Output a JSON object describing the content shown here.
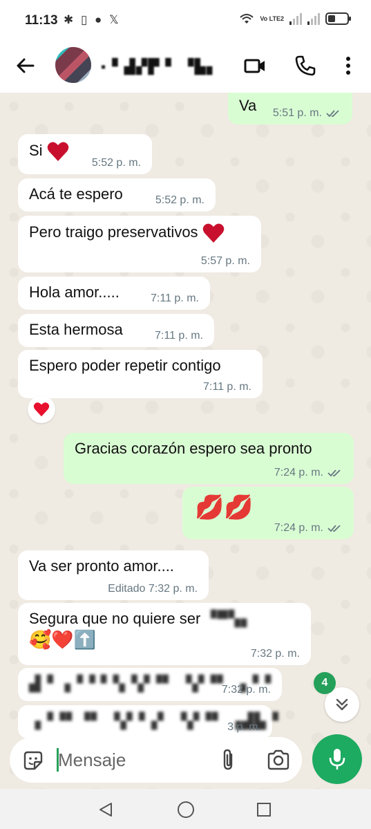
{
  "status_bar": {
    "time": "11:13",
    "left_icons": "✱ ▯ ● 𝕏",
    "network_label": "Vo LTE2"
  },
  "header": {
    "contact_name": "▪ ▘▟▞▛ ▘ ▝▙▖"
  },
  "messages": [
    {
      "dir": "out",
      "text": "Va",
      "time": "5:51 p. m.",
      "read": true
    },
    {
      "dir": "in",
      "text": "Si",
      "emoji": "red-heart",
      "time": "5:52 p. m."
    },
    {
      "dir": "in",
      "text": "Acá te espero",
      "time": "5:52 p. m."
    },
    {
      "dir": "in",
      "text": "Pero traigo preservativos",
      "emoji": "red-heart",
      "time": "5:57 p. m."
    },
    {
      "dir": "in",
      "text": "Hola amor.....",
      "time": "7:11 p. m."
    },
    {
      "dir": "in",
      "text": "Esta hermosa",
      "time": "7:11 p. m."
    },
    {
      "dir": "in",
      "text": "Espero poder repetir contigo",
      "time": "7:11 p. m.",
      "reaction": "red-heart"
    },
    {
      "dir": "out",
      "text": "Gracias corazón espero sea pronto",
      "time": "7:24 p. m.",
      "read": true
    },
    {
      "dir": "out",
      "text": "💋💋",
      "time": "7:24 p. m.",
      "read": true
    },
    {
      "dir": "in",
      "text": "Va ser pronto  amor....",
      "time": "Editado 7:32 p. m."
    },
    {
      "dir": "in",
      "text": "Segura que no quiere ser",
      "blurred_tail": "▝▀▚▖",
      "emoji_line": "🥰❤️⬆️",
      "time": "7:32 p. m."
    },
    {
      "dir": "in",
      "text": "▟▝ ▗▝▝ ▘▚▝▞▝▘ ▝▞▝▘ ▗▝▝",
      "time": "7:32 p. m.",
      "blurred": true
    },
    {
      "dir": "in",
      "text": "▗▝▝▘▝▘ ▝▞▝▗▘ ▝▞▝▘ ▗▟▙▝",
      "time": "3 p. m.",
      "blurred": true
    }
  ],
  "scroll_down": {
    "unread_count": "4"
  },
  "input": {
    "placeholder": "Mensaje"
  },
  "colors": {
    "outgoing_bubble": "#d9fdd3",
    "incoming_bubble": "#ffffff",
    "chat_background": "#efeae2",
    "accent_green": "#1daa61",
    "read_ticks": "#667781"
  },
  "icons": {
    "header": [
      "back-arrow-icon",
      "video-call-icon",
      "phone-icon",
      "more-options-icon"
    ],
    "input": [
      "sticker-icon",
      "attach-icon",
      "camera-icon",
      "mic-icon"
    ],
    "nav": [
      "nav-back-icon",
      "nav-home-icon",
      "nav-recents-icon"
    ]
  }
}
